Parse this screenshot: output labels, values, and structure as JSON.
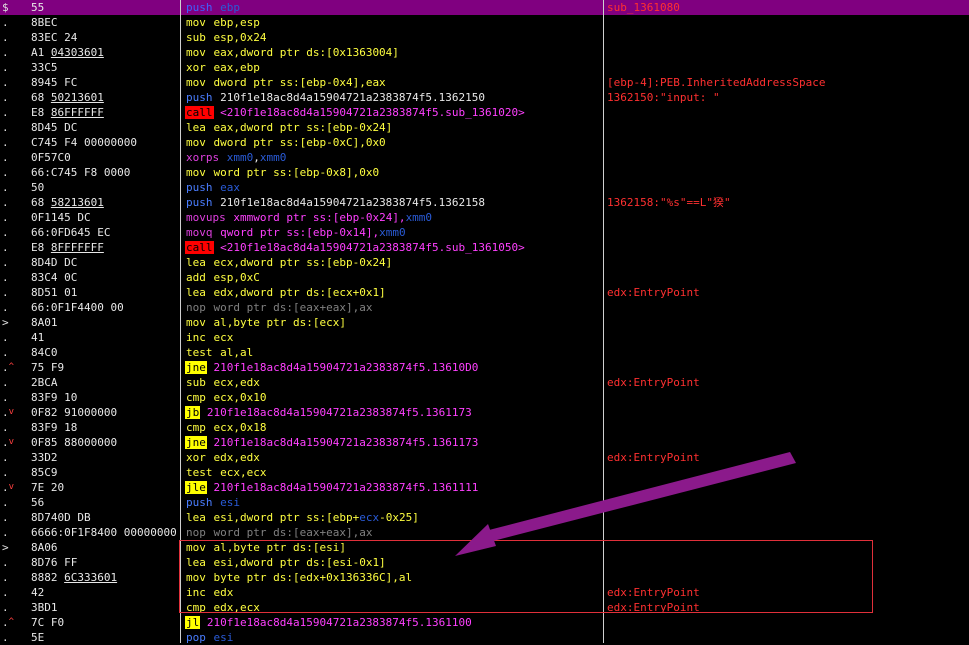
{
  "rows": [
    {
      "gutter": "$",
      "bytes": [
        {
          "t": "55"
        }
      ],
      "mnemonic": "push",
      "mtype": "push",
      "operands": [
        {
          "t": " ebp",
          "c": "op-blue"
        }
      ],
      "comment": "sub_1361080",
      "selected": true
    },
    {
      "gutter": ".",
      "bytes": [
        {
          "t": "8BEC"
        }
      ],
      "mnemonic": "mov",
      "mtype": "mov",
      "operands": [
        {
          "t": " ebp,esp",
          "c": "op-yellow"
        }
      ],
      "comment": ""
    },
    {
      "gutter": ".",
      "bytes": [
        {
          "t": "83EC 24"
        }
      ],
      "mnemonic": "sub",
      "mtype": "sub",
      "operands": [
        {
          "t": " esp,0x24",
          "c": "op-yellow"
        }
      ],
      "comment": ""
    },
    {
      "gutter": ".",
      "bytes": [
        {
          "t": "A1 "
        },
        {
          "t": "04303601",
          "u": true
        }
      ],
      "mnemonic": "mov",
      "mtype": "mov",
      "operands": [
        {
          "t": " eax,dword ptr ds:[0x1363004]",
          "c": "op-yellow"
        }
      ],
      "comment": ""
    },
    {
      "gutter": ".",
      "bytes": [
        {
          "t": "33C5"
        }
      ],
      "mnemonic": "xor",
      "mtype": "xor",
      "operands": [
        {
          "t": " eax,ebp",
          "c": "op-yellow"
        }
      ],
      "comment": ""
    },
    {
      "gutter": ".",
      "bytes": [
        {
          "t": "8945 FC"
        }
      ],
      "mnemonic": "mov",
      "mtype": "mov",
      "operands": [
        {
          "t": " dword ptr ss:[ebp-0x4],eax",
          "c": "op-yellow"
        }
      ],
      "comment": "[ebp-4]:PEB.InheritedAddressSpace"
    },
    {
      "gutter": ".",
      "bytes": [
        {
          "t": "68 "
        },
        {
          "t": "50213601",
          "u": true
        }
      ],
      "mnemonic": "push",
      "mtype": "push",
      "operands": [
        {
          "t": " 210f1e18ac8d4a15904721a2383874f5.1362150",
          "c": "op"
        }
      ],
      "comment": "1362150:\"input: \""
    },
    {
      "gutter": ".",
      "bytes": [
        {
          "t": "E8 "
        },
        {
          "t": "86FFFFFF",
          "u": true
        }
      ],
      "mnemonic": "call",
      "mtype": "call",
      "operands": [
        {
          "t": " <210f1e18ac8d4a15904721a2383874f5.sub_1361020>",
          "c": "op-magenta"
        }
      ],
      "comment": ""
    },
    {
      "gutter": ".",
      "bytes": [
        {
          "t": "8D45 DC"
        }
      ],
      "mnemonic": "lea",
      "mtype": "lea",
      "operands": [
        {
          "t": " eax,dword ptr ss:[ebp-0x24]",
          "c": "op-yellow"
        }
      ],
      "comment": ""
    },
    {
      "gutter": ".",
      "bytes": [
        {
          "t": "C745 F4 00000000"
        }
      ],
      "mnemonic": "mov",
      "mtype": "mov",
      "operands": [
        {
          "t": " dword ptr ss:[ebp-0xC],0x0",
          "c": "op-yellow"
        }
      ],
      "comment": ""
    },
    {
      "gutter": ".",
      "bytes": [
        {
          "t": "0F57C0"
        }
      ],
      "mnemonic": "xorps",
      "mtype": "xmm",
      "operands": [
        {
          "t": " ",
          "c": "op"
        },
        {
          "t": "xmm0",
          "c": "op-blue"
        },
        {
          "t": ",",
          "c": "op"
        },
        {
          "t": "xmm0",
          "c": "op-blue"
        }
      ],
      "comment": ""
    },
    {
      "gutter": ".",
      "bytes": [
        {
          "t": "66:C745 F8 0000"
        }
      ],
      "mnemonic": "mov",
      "mtype": "mov",
      "operands": [
        {
          "t": " word ptr ss:[ebp-0x8],0x0",
          "c": "op-yellow"
        }
      ],
      "comment": ""
    },
    {
      "gutter": ".",
      "bytes": [
        {
          "t": "50"
        }
      ],
      "mnemonic": "push",
      "mtype": "push",
      "operands": [
        {
          "t": " eax",
          "c": "op-blue"
        }
      ],
      "comment": ""
    },
    {
      "gutter": ".",
      "bytes": [
        {
          "t": "68 "
        },
        {
          "t": "58213601",
          "u": true
        }
      ],
      "mnemonic": "push",
      "mtype": "push",
      "operands": [
        {
          "t": " 210f1e18ac8d4a15904721a2383874f5.1362158",
          "c": "op"
        }
      ],
      "comment": "1362158:\"%s\"==L\"猤\""
    },
    {
      "gutter": ".",
      "bytes": [
        {
          "t": "0F1145 DC"
        }
      ],
      "mnemonic": "movups",
      "mtype": "xmm",
      "operands": [
        {
          "t": " xmmword ptr ss:[ebp-0x24],",
          "c": "op-magenta"
        },
        {
          "t": "xmm0",
          "c": "op-blue"
        }
      ],
      "comment": ""
    },
    {
      "gutter": ".",
      "bytes": [
        {
          "t": "66:0FD645 EC"
        }
      ],
      "mnemonic": "movq",
      "mtype": "xmm",
      "operands": [
        {
          "t": " qword ptr ss:[ebp-0x14],",
          "c": "op-magenta"
        },
        {
          "t": "xmm0",
          "c": "op-blue"
        }
      ],
      "comment": ""
    },
    {
      "gutter": ".",
      "bytes": [
        {
          "t": "E8 "
        },
        {
          "t": "8FFFFFFF",
          "u": true
        }
      ],
      "mnemonic": "call",
      "mtype": "call",
      "operands": [
        {
          "t": " <210f1e18ac8d4a15904721a2383874f5.sub_1361050>",
          "c": "op-magenta"
        }
      ],
      "comment": ""
    },
    {
      "gutter": ".",
      "bytes": [
        {
          "t": "8D4D DC"
        }
      ],
      "mnemonic": "lea",
      "mtype": "lea",
      "operands": [
        {
          "t": " ecx,dword ptr ss:[ebp-0x24]",
          "c": "op-yellow"
        }
      ],
      "comment": ""
    },
    {
      "gutter": ".",
      "bytes": [
        {
          "t": "83C4 0C"
        }
      ],
      "mnemonic": "add",
      "mtype": "add",
      "operands": [
        {
          "t": " esp,0xC",
          "c": "op-yellow"
        }
      ],
      "comment": ""
    },
    {
      "gutter": ".",
      "bytes": [
        {
          "t": "8D51 01"
        }
      ],
      "mnemonic": "lea",
      "mtype": "lea",
      "operands": [
        {
          "t": " edx,dword ptr ds:[ecx+0x1]",
          "c": "op-yellow"
        }
      ],
      "comment": "edx:EntryPoint"
    },
    {
      "gutter": ".",
      "bytes": [
        {
          "t": "66:0F1F4400 00"
        }
      ],
      "mnemonic": "nop",
      "mtype": "nop",
      "operands": [
        {
          "t": " word ptr ds:[eax+eax],ax",
          "c": "op-nop"
        }
      ],
      "comment": ""
    },
    {
      "gutter": ">",
      "bytes": [
        {
          "t": "8A01"
        }
      ],
      "mnemonic": "mov",
      "mtype": "mov",
      "operands": [
        {
          "t": " al,byte ptr ds:[ecx]",
          "c": "op-yellow"
        }
      ],
      "comment": ""
    },
    {
      "gutter": ".",
      "bytes": [
        {
          "t": "41"
        }
      ],
      "mnemonic": "inc",
      "mtype": "inc",
      "operands": [
        {
          "t": " ecx",
          "c": "op-yellow"
        }
      ],
      "comment": ""
    },
    {
      "gutter": ".",
      "bytes": [
        {
          "t": "84C0"
        }
      ],
      "mnemonic": "test",
      "mtype": "test",
      "operands": [
        {
          "t": " al,al",
          "c": "op-yellow"
        }
      ],
      "comment": ""
    },
    {
      "gutter": ".",
      "arrow": "^",
      "bytes": [
        {
          "t": "75 F9"
        }
      ],
      "mnemonic": "jne",
      "mtype": "jcc",
      "operands": [
        {
          "t": " 210f1e18ac8d4a15904721a2383874f5.13610D0",
          "c": "op-magenta"
        }
      ],
      "comment": ""
    },
    {
      "gutter": ".",
      "bytes": [
        {
          "t": "2BCA"
        }
      ],
      "mnemonic": "sub",
      "mtype": "sub",
      "operands": [
        {
          "t": " ecx,edx",
          "c": "op-yellow"
        }
      ],
      "comment": "edx:EntryPoint"
    },
    {
      "gutter": ".",
      "bytes": [
        {
          "t": "83F9 10"
        }
      ],
      "mnemonic": "cmp",
      "mtype": "cmp",
      "operands": [
        {
          "t": " ecx,0x10",
          "c": "op-yellow"
        }
      ],
      "comment": ""
    },
    {
      "gutter": ".",
      "arrow": "v",
      "bytes": [
        {
          "t": "0F82 91000000"
        }
      ],
      "mnemonic": "jb",
      "mtype": "jcc",
      "operands": [
        {
          "t": " 210f1e18ac8d4a15904721a2383874f5.1361173",
          "c": "op-magenta"
        }
      ],
      "comment": ""
    },
    {
      "gutter": ".",
      "bytes": [
        {
          "t": "83F9 18"
        }
      ],
      "mnemonic": "cmp",
      "mtype": "cmp",
      "operands": [
        {
          "t": " ecx,0x18",
          "c": "op-yellow"
        }
      ],
      "comment": ""
    },
    {
      "gutter": ".",
      "arrow": "v",
      "bytes": [
        {
          "t": "0F85 88000000"
        }
      ],
      "mnemonic": "jne",
      "mtype": "jcc",
      "operands": [
        {
          "t": " 210f1e18ac8d4a15904721a2383874f5.1361173",
          "c": "op-magenta"
        }
      ],
      "comment": ""
    },
    {
      "gutter": ".",
      "bytes": [
        {
          "t": "33D2"
        }
      ],
      "mnemonic": "xor",
      "mtype": "xor",
      "operands": [
        {
          "t": " edx,edx",
          "c": "op-yellow"
        }
      ],
      "comment": "edx:EntryPoint"
    },
    {
      "gutter": ".",
      "bytes": [
        {
          "t": "85C9"
        }
      ],
      "mnemonic": "test",
      "mtype": "test",
      "operands": [
        {
          "t": " ecx,ecx",
          "c": "op-yellow"
        }
      ],
      "comment": ""
    },
    {
      "gutter": ".",
      "arrow": "v",
      "bytes": [
        {
          "t": "7E 20"
        }
      ],
      "mnemonic": "jle",
      "mtype": "jcc",
      "operands": [
        {
          "t": " 210f1e18ac8d4a15904721a2383874f5.1361111",
          "c": "op-magenta"
        }
      ],
      "comment": ""
    },
    {
      "gutter": ".",
      "bytes": [
        {
          "t": "56"
        }
      ],
      "mnemonic": "push",
      "mtype": "push",
      "operands": [
        {
          "t": " esi",
          "c": "op-blue"
        }
      ],
      "comment": ""
    },
    {
      "gutter": ".",
      "bytes": [
        {
          "t": "8D740D DB"
        }
      ],
      "mnemonic": "lea",
      "mtype": "lea",
      "operands": [
        {
          "t": " esi,dword ptr ss:[ebp+",
          "c": "op-yellow"
        },
        {
          "t": "ecx",
          "c": "op-blue"
        },
        {
          "t": "-0x25]",
          "c": "op-yellow"
        }
      ],
      "comment": ""
    },
    {
      "gutter": ".",
      "bytes": [
        {
          "t": "6666:0F1F8400 00000000"
        }
      ],
      "mnemonic": "nop",
      "mtype": "nop",
      "operands": [
        {
          "t": " word ptr ds:[eax+eax],ax",
          "c": "op-nop"
        }
      ],
      "comment": ""
    },
    {
      "gutter": ">",
      "bytes": [
        {
          "t": "8A06"
        }
      ],
      "mnemonic": "mov",
      "mtype": "mov",
      "operands": [
        {
          "t": " al,byte ptr ds:[esi]",
          "c": "op-yellow"
        }
      ],
      "comment": ""
    },
    {
      "gutter": ".",
      "bytes": [
        {
          "t": "8D76 FF"
        }
      ],
      "mnemonic": "lea",
      "mtype": "lea",
      "operands": [
        {
          "t": " esi,dword ptr ds:[esi-0x1]",
          "c": "op-yellow"
        }
      ],
      "comment": ""
    },
    {
      "gutter": ".",
      "bytes": [
        {
          "t": "8882 "
        },
        {
          "t": "6C333601",
          "u": true
        }
      ],
      "mnemonic": "mov",
      "mtype": "mov",
      "operands": [
        {
          "t": " byte ptr ds:[edx+0x136336C],al",
          "c": "op-yellow"
        }
      ],
      "comment": ""
    },
    {
      "gutter": ".",
      "bytes": [
        {
          "t": "42"
        }
      ],
      "mnemonic": "inc",
      "mtype": "inc",
      "operands": [
        {
          "t": " edx",
          "c": "op-yellow"
        }
      ],
      "comment": "edx:EntryPoint"
    },
    {
      "gutter": ".",
      "bytes": [
        {
          "t": "3BD1"
        }
      ],
      "mnemonic": "cmp",
      "mtype": "cmp",
      "operands": [
        {
          "t": " edx,ecx",
          "c": "op-yellow"
        }
      ],
      "comment": "edx:EntryPoint"
    },
    {
      "gutter": ".",
      "arrow": "^",
      "bytes": [
        {
          "t": "7C F0"
        }
      ],
      "mnemonic": "jl",
      "mtype": "jcc",
      "operands": [
        {
          "t": " 210f1e18ac8d4a15904721a2383874f5.1361100",
          "c": "op-magenta"
        }
      ],
      "comment": ""
    },
    {
      "gutter": ".",
      "bytes": [
        {
          "t": "5E"
        }
      ],
      "mnemonic": "pop",
      "mtype": "pop",
      "operands": [
        {
          "t": " esi",
          "c": "op-blue"
        }
      ],
      "comment": ""
    }
  ],
  "colors": {
    "background": "#000000",
    "selection": "#800080",
    "annotation": "#8b1a8b",
    "highlight_box": "#e0303a",
    "comment": "#ff3030"
  }
}
